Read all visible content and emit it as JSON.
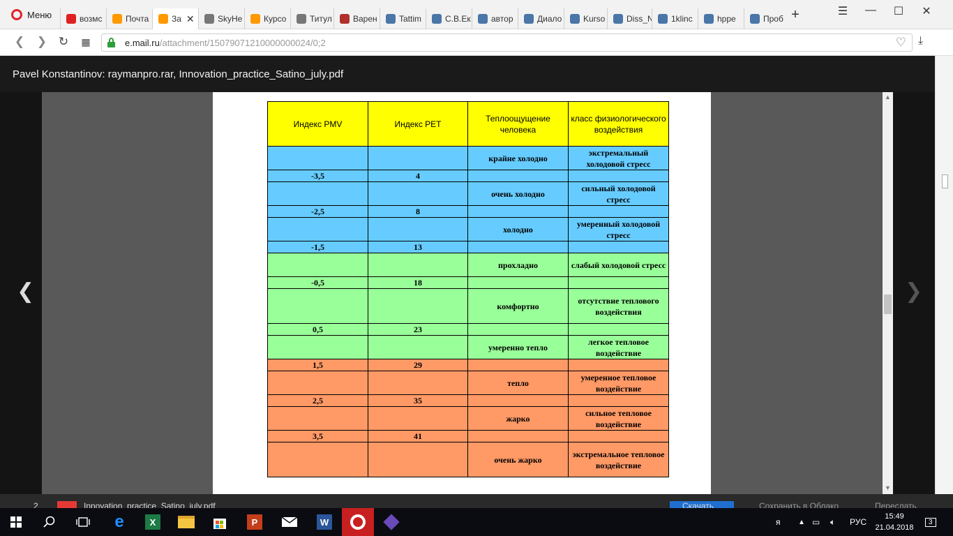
{
  "browser": {
    "menu_label": "Меню",
    "tabs": [
      {
        "label": "возмс",
        "icon": "yandex-icon",
        "color": "#e02020"
      },
      {
        "label": "Почта",
        "icon": "mailru-icon",
        "color": "#ff9900"
      },
      {
        "label": "За",
        "icon": "mailru-icon",
        "color": "#ff9900",
        "active": true
      },
      {
        "label": "SkyHe",
        "icon": "document-icon",
        "color": "#777777"
      },
      {
        "label": "Курсо",
        "icon": "mailru-icon",
        "color": "#ff9900"
      },
      {
        "label": "Титул",
        "icon": "document-icon",
        "color": "#777777"
      },
      {
        "label": "Варен",
        "icon": "kremlin-icon",
        "color": "#b0302a"
      },
      {
        "label": "Tattim",
        "icon": "vk-icon",
        "color": "#4a76a8"
      },
      {
        "label": "С.В.Ек",
        "icon": "vk-icon",
        "color": "#4a76a8"
      },
      {
        "label": "автор",
        "icon": "vk-icon",
        "color": "#4a76a8"
      },
      {
        "label": "Диало",
        "icon": "chat-icon",
        "color": "#4a76a8"
      },
      {
        "label": "Kurso",
        "icon": "vk-icon",
        "color": "#4a76a8"
      },
      {
        "label": "Diss_N",
        "icon": "vk-icon",
        "color": "#4a76a8"
      },
      {
        "label": "1klinc",
        "icon": "vk-icon",
        "color": "#4a76a8"
      },
      {
        "label": "hppe",
        "icon": "vk-icon",
        "color": "#4a76a8"
      },
      {
        "label": "Проб",
        "icon": "vk-icon",
        "color": "#4a76a8"
      }
    ],
    "url_host": "e.mail.ru",
    "url_path": "/attachment/15079071210000000024/0;2"
  },
  "viewer": {
    "title": "Pavel Konstantinov: raymanpro.rar, Innovation_practice_Satino_july.pdf"
  },
  "table": {
    "headers": [
      "Индекс  PMV",
      "Индекс  PET",
      "Теплоощущение человека",
      "класс физиологического воздействия"
    ],
    "rows": [
      {
        "color": "blue",
        "pmv": "",
        "pet": "",
        "feel": "крайне холодно",
        "class": "экстремальный холодовой стресс"
      },
      {
        "color": "blue",
        "pmv": "-3,5",
        "pet": "4",
        "feel": "",
        "class": ""
      },
      {
        "color": "blue",
        "pmv": "",
        "pet": "",
        "feel": "очень холодно",
        "class": "сильный холодовой стресс"
      },
      {
        "color": "blue",
        "pmv": "-2,5",
        "pet": "8",
        "feel": "",
        "class": ""
      },
      {
        "color": "blue",
        "pmv": "",
        "pet": "",
        "feel": "холодно",
        "class": "умеренный холодовой стресс"
      },
      {
        "color": "blue",
        "pmv": "-1,5",
        "pet": "13",
        "feel": "",
        "class": ""
      },
      {
        "color": "green",
        "pmv": "",
        "pet": "",
        "feel": "прохладно",
        "class": "слабый холодовой стресс"
      },
      {
        "color": "green",
        "pmv": "-0,5",
        "pet": "18",
        "feel": "",
        "class": ""
      },
      {
        "color": "green",
        "pmv": "",
        "pet": "",
        "feel": "комфортно",
        "class": "отсутствие теплового воздействия"
      },
      {
        "color": "green",
        "pmv": "0,5",
        "pet": "23",
        "feel": "",
        "class": ""
      },
      {
        "color": "green",
        "pmv": "",
        "pet": "",
        "feel": "умеренно тепло",
        "class": "легкое тепловое воздействие"
      },
      {
        "color": "orange",
        "pmv": "1,5",
        "pet": "29",
        "feel": "",
        "class": ""
      },
      {
        "color": "orange",
        "pmv": "",
        "pet": "",
        "feel": "тепло",
        "class": "умеренное тепловое воздействие"
      },
      {
        "color": "orange",
        "pmv": "2,5",
        "pet": "35",
        "feel": "",
        "class": ""
      },
      {
        "color": "orange",
        "pmv": "",
        "pet": "",
        "feel": "жарко",
        "class": "сильное тепловое воздействие"
      },
      {
        "color": "orange",
        "pmv": "3,5",
        "pet": "41",
        "feel": "",
        "class": ""
      },
      {
        "color": "orange",
        "pmv": "",
        "pet": "",
        "feel": "очень жарко",
        "class": "экстремальное тепловое воздействие"
      }
    ]
  },
  "download_bar": {
    "count": "2",
    "filename": "Innovation_practice_Satino_july.pdf",
    "download_label": "Скачать",
    "save_cloud_label": "Сохранить в Облако",
    "forward_label": "Переслать"
  },
  "taskbar": {
    "language": "РУС",
    "time": "15:49",
    "date": "21.04.2018",
    "notifications": "3"
  },
  "colors": {
    "header_yellow": "#ffff00",
    "cold_blue": "#66ccff",
    "comfort_green": "#99ff99",
    "warm_orange": "#ff9966"
  }
}
